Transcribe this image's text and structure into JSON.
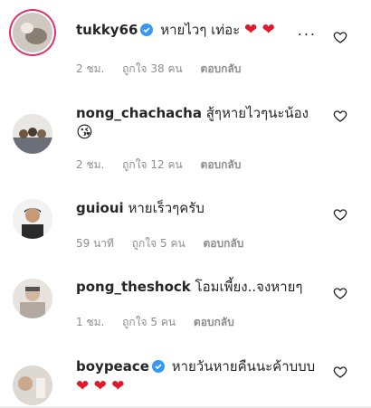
{
  "comments": [
    {
      "username": "tukky66",
      "verified": true,
      "text": "หายไวๆ เท่อะ",
      "emoji": "❤ ❤",
      "time": "2 ชม.",
      "likes": "ถูกใจ 38 คน",
      "reply": "ตอบกลับ",
      "more": "..."
    },
    {
      "username": "nong_chachacha",
      "verified": false,
      "text": "สู้ๆหายไวๆนะน้อง",
      "emoji": "😘",
      "time": "2 ชม.",
      "likes": "ถูกใจ 12 คน",
      "reply": "ตอบกลับ"
    },
    {
      "username": "guioui",
      "verified": false,
      "text": "หายเร็วๆครับ",
      "time": "59 นาที",
      "likes": "ถูกใจ 5 คน",
      "reply": "ตอบกลับ"
    },
    {
      "username": "pong_theshock",
      "verified": false,
      "text": "โอมเพี้ยง..จงหายๆ",
      "time": "1 ชม.",
      "likes": "ถูกใจ 5 คน",
      "reply": "ตอบกลับ"
    },
    {
      "username": "boypeace",
      "verified": true,
      "text": "หายวันหายคืนนะค้าบบบ",
      "emoji": "❤ ❤ ❤"
    }
  ],
  "colors": {
    "verified": "#3897f0",
    "heart": "#e0192b",
    "meta": "#8e8e8e"
  },
  "icons": {
    "like": "heart-outline-icon",
    "verified": "verified-badge-icon",
    "more": "more-icon"
  }
}
